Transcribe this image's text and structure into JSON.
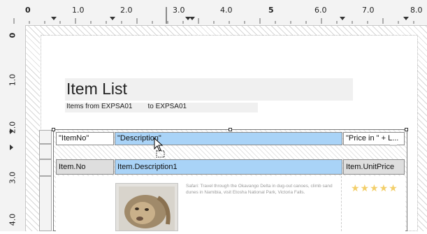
{
  "ruler": {
    "top_labels": [
      "0",
      "1.0",
      "2.0",
      "3.0",
      "4.0",
      "5",
      "6.0",
      "7.0",
      "8.0"
    ],
    "left_labels": [
      "0",
      "1.0",
      "2.0",
      "3.0",
      "4.0"
    ]
  },
  "report": {
    "title": "Item List",
    "subtitle_from": "Items from EXPSA01",
    "subtitle_to": "to EXPSA01"
  },
  "header_row": {
    "item_no": "\"ItemNo\"",
    "description": "\"Description\"",
    "price": "\"Price in \" + L..."
  },
  "detail_row": {
    "item_no": "Item.No",
    "description": "Item.Description1",
    "unit_price": "Item.UnitPrice"
  },
  "preview": {
    "image": "lion-photo",
    "text": "Safari: Travel through the Okavango Delta in dug-out canoes, climb sand dunes in Namibia, visit Etosha National Park, Victoria Falls.",
    "stars": "★★★★★"
  },
  "colors": {
    "field_blue": "#a9d3f7",
    "star": "#f3cf6a"
  }
}
